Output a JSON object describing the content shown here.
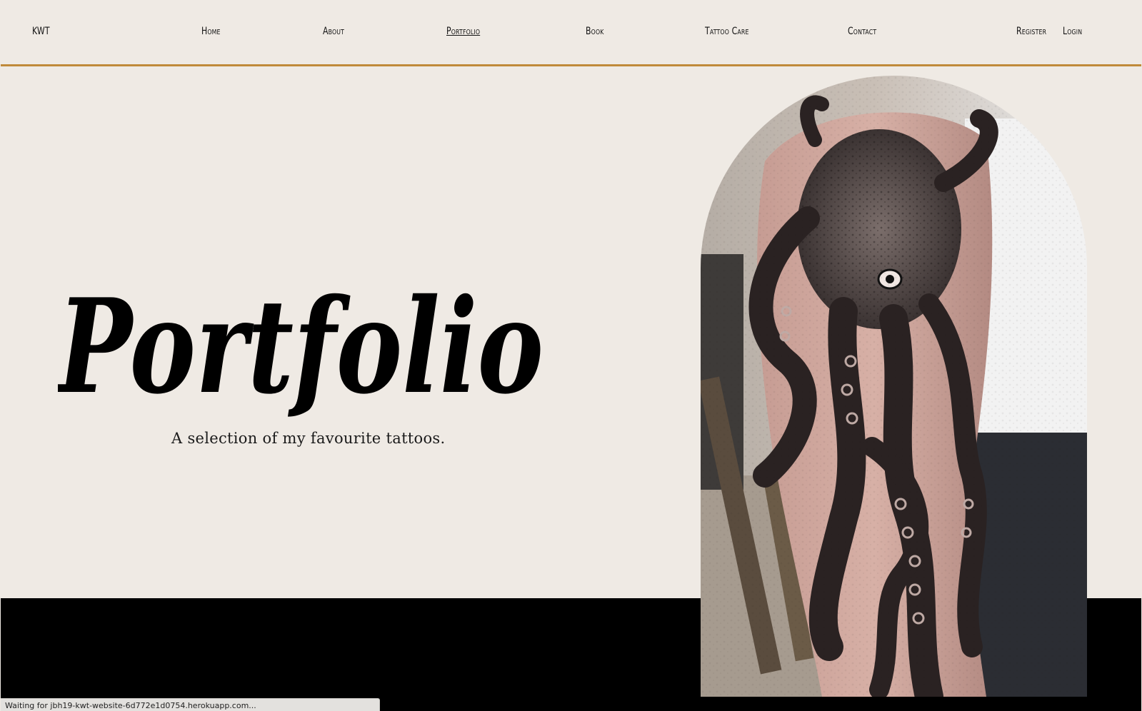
{
  "nav": {
    "brand": "KWT",
    "links": [
      {
        "label": "Home"
      },
      {
        "label": "About"
      },
      {
        "label": "Portfolio"
      },
      {
        "label": "Book"
      },
      {
        "label": "Tattoo Care"
      },
      {
        "label": "Contact"
      }
    ],
    "auth": [
      {
        "label": "Register"
      },
      {
        "label": "Login"
      }
    ]
  },
  "hero": {
    "title": "Portfolio",
    "subtitle": "A selection of my favourite tattoos."
  },
  "image": {
    "subject": "octopus-tattoo-photo"
  },
  "status_bar": {
    "text": "Waiting for jbh19-kwt-website-6d772e1d0754.herokuapp.com..."
  },
  "colors": {
    "background": "#efeae4",
    "accent": "#c08a3a",
    "band": "#000000",
    "text": "#111111"
  }
}
